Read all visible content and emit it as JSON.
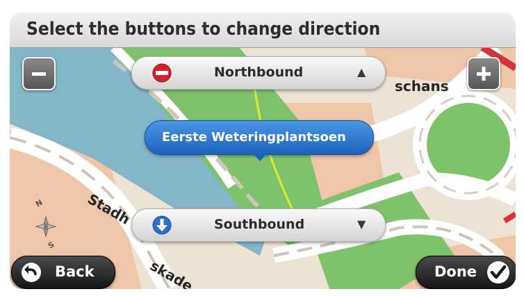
{
  "header": {
    "title": "Select the buttons to change direction"
  },
  "map": {
    "street_labels": {
      "upper_right": "schans",
      "lower_left_a": "Stadh",
      "lower_left_b": "skade"
    },
    "compass": {
      "north": "N",
      "south": "S"
    }
  },
  "zoom": {
    "out_icon": "minus-icon",
    "in_icon": "plus-icon"
  },
  "direction": {
    "north": {
      "label": "Northbound",
      "icon": "no-entry-icon",
      "arrow": "▲"
    },
    "south": {
      "label": "Southbound",
      "icon": "down-arrow-icon",
      "arrow": "▼"
    }
  },
  "road": {
    "name": "Eerste Weteringplantsoen"
  },
  "footer": {
    "back_label": "Back",
    "done_label": "Done",
    "back_icon": "back-arrow-icon",
    "done_icon": "checkmark-icon"
  },
  "colors": {
    "water": "#82b6c8",
    "park": "#7ec36b",
    "building": "#f0c6a8",
    "road": "#ffffff",
    "highlight": "#e0ea2c",
    "selected_road": "#2a73cc"
  }
}
